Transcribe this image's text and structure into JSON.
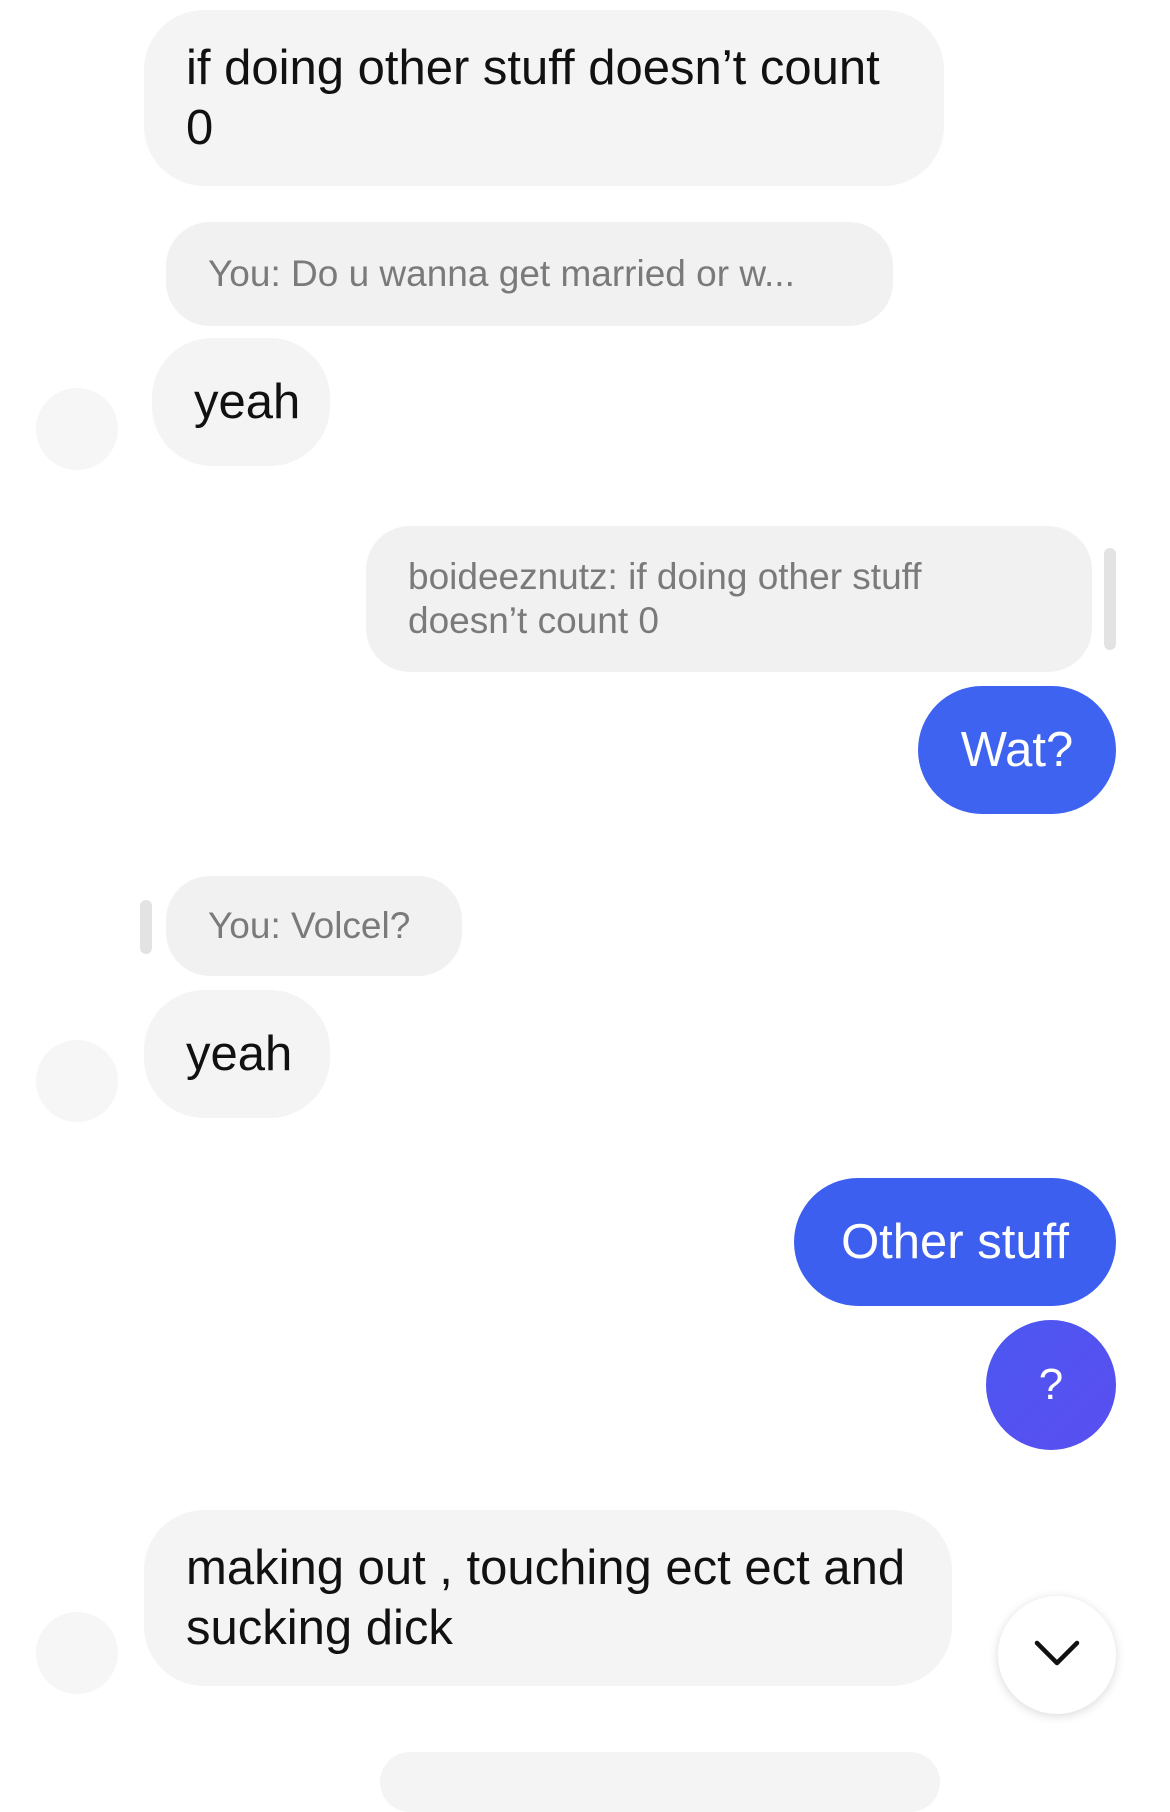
{
  "conversation": {
    "messages": [
      {
        "lines": [
          "if doing other stuff doesn’t count",
          "0"
        ]
      },
      {
        "reply_preview": "You: Do u wanna get married or w..."
      },
      {
        "text": "yeah"
      },
      {
        "reply_preview_lines": [
          "boideeznutz: if doing other stuff",
          "doesn’t count 0"
        ]
      },
      {
        "text": "Wat?"
      },
      {
        "reply_preview": "You: Volcel?"
      },
      {
        "text": "yeah"
      },
      {
        "text": "Other stuff"
      },
      {
        "text": "?"
      },
      {
        "lines": [
          "making out , touching ect ect and",
          "sucking dick"
        ]
      }
    ]
  },
  "colors": {
    "outgoing": "#3d63f0",
    "outgoing_gradient_end": "#5a4ef0",
    "incoming": "#f4f4f4"
  },
  "icons": {
    "scroll_down": "chevron-down-icon"
  }
}
